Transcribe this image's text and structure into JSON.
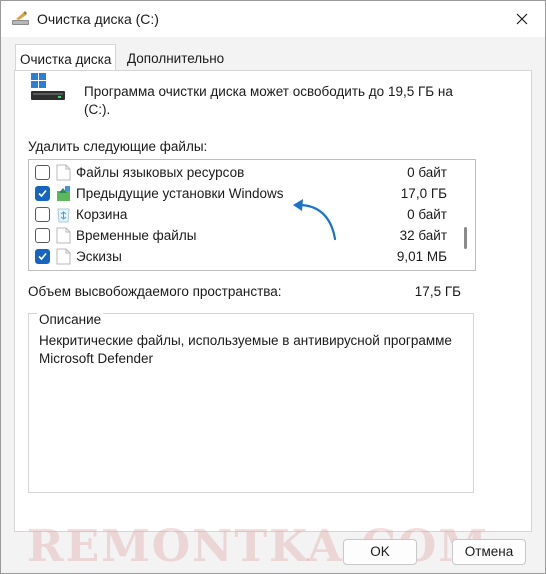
{
  "window": {
    "title": "Очистка диска  (C:)"
  },
  "tabs": [
    {
      "label": "Очистка диска",
      "active": true
    },
    {
      "label": "Дополнительно",
      "active": false
    }
  ],
  "info": {
    "text": "Программа очистки диска может освободить до 19,5 ГБ на (C:)."
  },
  "files_section": {
    "label": "Удалить следующие файлы:",
    "items": [
      {
        "name": "Файлы языковых ресурсов",
        "size": "0 байт",
        "checked": false,
        "icon": "blank-file-icon"
      },
      {
        "name": "Предыдущие установки Windows",
        "size": "17,0 ГБ",
        "checked": true,
        "icon": "windows-setup-icon"
      },
      {
        "name": "Корзина",
        "size": "0 байт",
        "checked": false,
        "icon": "recycle-bin-icon"
      },
      {
        "name": "Временные файлы",
        "size": "32 байт",
        "checked": false,
        "icon": "blank-file-icon"
      },
      {
        "name": "Эскизы",
        "size": "9,01 МБ",
        "checked": true,
        "icon": "blank-file-icon"
      }
    ]
  },
  "space": {
    "label": "Объем высвобождаемого пространства:",
    "value": "17,5 ГБ"
  },
  "description": {
    "title": "Описание",
    "text": "Некритические файлы, используемые в антивирусной программе Microsoft Defender"
  },
  "watermark": "REMONTKA.COM",
  "buttons": {
    "ok": "OK",
    "cancel": "Отмена"
  },
  "colors": {
    "accent": "#1565c0",
    "window_bg": "#f3f3f3",
    "panel_bg": "#ffffff"
  }
}
